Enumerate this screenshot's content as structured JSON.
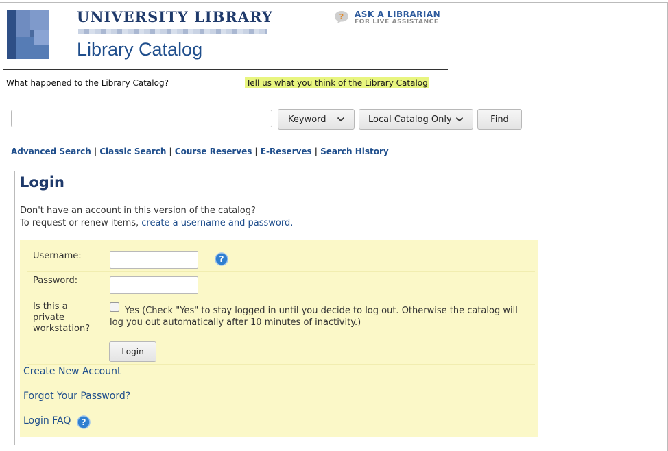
{
  "header": {
    "university_name": "UNIVERSITY LIBRARY",
    "catalog_title": "Library Catalog",
    "ask_librarian": {
      "title": "ASK A LIBRARIAN",
      "subtitle": "FOR LIVE ASSISTANCE",
      "icon": "question-bubble-icon"
    }
  },
  "notice": {
    "what_happened": "What happened to the Library Catalog?",
    "feedback": "Tell us what you think of the Library Catalog",
    "feedback_highlight": "#e8f57f"
  },
  "search": {
    "query_value": "",
    "type_selected": "Keyword",
    "scope_selected": "Local Catalog Only",
    "find_label": "Find"
  },
  "links": [
    "Advanced Search",
    "Classic Search",
    "Course Reserves",
    "E-Reserves",
    "Search History"
  ],
  "login": {
    "heading": "Login",
    "intro_line1": "Don't have an account in this version of the catalog?",
    "intro_line2_prefix": "To request or renew items, ",
    "intro_line2_link": "create a username and password.",
    "username_label": "Username:",
    "username_value": "",
    "password_label": "Password:",
    "password_value": "",
    "private_label": "Is this a private workstation?",
    "private_checked": false,
    "private_text": "Yes  (Check \"Yes\" to stay logged in until you decide to log out. Otherwise the catalog will log you out automatically after 10 minutes of inactivity.)",
    "login_button": "Login",
    "create_account": "Create New Account",
    "forgot_password": "Forgot Your Password?",
    "login_faq": "Login FAQ"
  },
  "colors": {
    "brand_blue": "#1f3a6b",
    "link_blue": "#1f4e8c",
    "form_background": "#fbf8c8",
    "help_icon": "#2f7fd0"
  }
}
